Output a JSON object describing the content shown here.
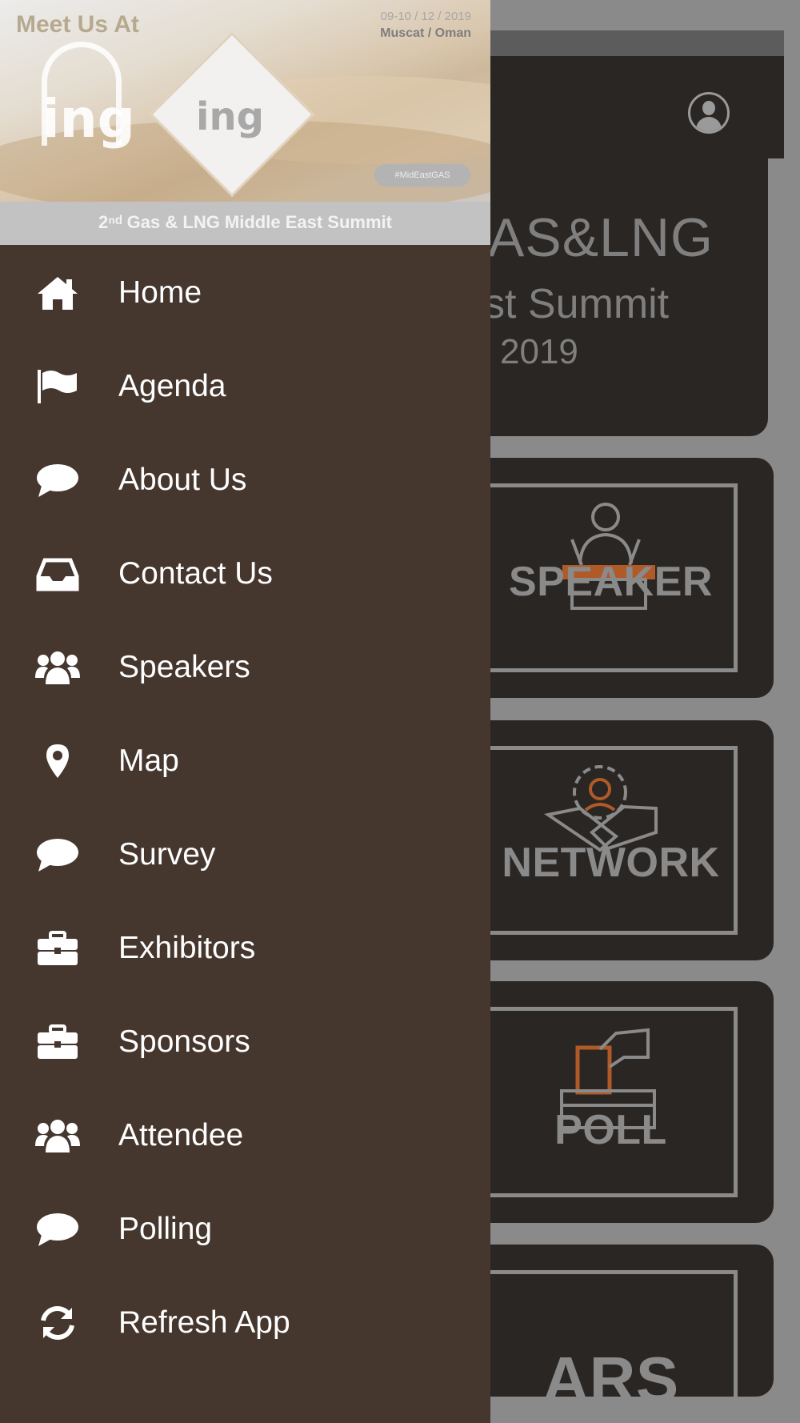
{
  "drawer": {
    "header": {
      "meet_text": "Meet Us At",
      "date": "09-10 / 12 / 2019",
      "location": "Muscat / Oman",
      "logo_text": "ing",
      "hashtag": "#MidEastGAS",
      "caption": "2ⁿᵈ Gas & LNG Middle East Summit"
    },
    "menu": [
      {
        "label": "Home",
        "icon": "home-icon"
      },
      {
        "label": "Agenda",
        "icon": "flag-icon"
      },
      {
        "label": "About Us",
        "icon": "comment-icon"
      },
      {
        "label": "Contact Us",
        "icon": "inbox-icon"
      },
      {
        "label": "Speakers",
        "icon": "users-icon"
      },
      {
        "label": "Map",
        "icon": "map-marker-icon"
      },
      {
        "label": "Survey",
        "icon": "comment-icon"
      },
      {
        "label": "Exhibitors",
        "icon": "briefcase-icon"
      },
      {
        "label": "Sponsors",
        "icon": "briefcase-icon"
      },
      {
        "label": "Attendee",
        "icon": "users-icon"
      },
      {
        "label": "Polling",
        "icon": "comment-icon"
      },
      {
        "label": "Refresh App",
        "icon": "refresh-icon"
      }
    ]
  },
  "background": {
    "banner_line1": "AS&LNG",
    "banner_line2": "st Summit",
    "banner_line3": "2019",
    "cards": [
      "SPEAKER",
      "NETWORK",
      "POLL",
      "ARS"
    ]
  },
  "colors": {
    "drawer_bg": "#45362e",
    "card_bg": "#2a2623",
    "accent": "#b05a28"
  }
}
